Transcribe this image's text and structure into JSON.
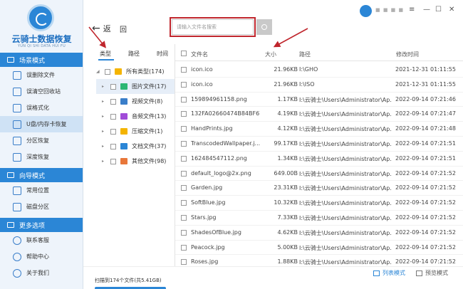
{
  "brand": {
    "title": "云骑士数据恢复",
    "subtitle": "YUN QI SHI DATA HUI FU"
  },
  "sidebar": {
    "sections": [
      {
        "label": "场景模式",
        "items": [
          "误删除文件",
          "误清空回收站",
          "误格式化",
          "U盘/内存卡恢复",
          "分区恢复",
          "深度恢复"
        ]
      },
      {
        "label": "向导模式",
        "items": [
          "常用位置",
          "磁盘分区"
        ]
      },
      {
        "label": "更多选项",
        "items": [
          "联系客服",
          "帮助中心",
          "关于我们"
        ]
      }
    ],
    "active_item": "U盘/内存卡恢复"
  },
  "topbar": {
    "back_label": "返",
    "refresh_label": "回",
    "search_placeholder": "请输入文件名搜索",
    "user_name": "■ ■ ■ ■"
  },
  "category_tabs": [
    "类型",
    "路径",
    "时间"
  ],
  "categories": [
    {
      "label": "所有类型(174)",
      "icon": "folder-icon",
      "color": "#f4b400"
    },
    {
      "label": "图片文件(17)",
      "icon": "image-icon",
      "color": "#2bb673"
    },
    {
      "label": "视频文件(8)",
      "icon": "video-icon",
      "color": "#3a7ec9"
    },
    {
      "label": "音频文件(13)",
      "icon": "audio-icon",
      "color": "#a04cd8"
    },
    {
      "label": "压缩文件(1)",
      "icon": "archive-icon",
      "color": "#f4b400"
    },
    {
      "label": "文档文件(37)",
      "icon": "document-icon",
      "color": "#2b86d6"
    },
    {
      "label": "其他文件(98)",
      "icon": "other-icon",
      "color": "#e8773a"
    }
  ],
  "table": {
    "headers": {
      "name": "文件名",
      "size": "大小",
      "path": "路径",
      "date": "修改时间"
    },
    "rows": [
      {
        "name": "icon.ico",
        "size": "21.96KB",
        "path": "I:\\GHO",
        "date": "2021-12-31 01:11:55"
      },
      {
        "name": "icon.ico",
        "size": "21.96KB",
        "path": "I:\\ISO",
        "date": "2021-12-31 01:11:55"
      },
      {
        "name": "159894961158.png",
        "size": "1.17KB",
        "path": "I:\\云骑士\\Users\\Administrator\\Ap...",
        "date": "2022-09-14 07:21:46"
      },
      {
        "name": "132FA02660474B84BF67...",
        "size": "4.19KB",
        "path": "I:\\云骑士\\Users\\Administrator\\Ap...",
        "date": "2022-09-14 07:21:47"
      },
      {
        "name": "HandPrints.jpg",
        "size": "4.12KB",
        "path": "I:\\云骑士\\Users\\Administrator\\Ap...",
        "date": "2022-09-14 07:21:48"
      },
      {
        "name": "TranscodedWallpaper.j...",
        "size": "99.17KB",
        "path": "I:\\云骑士\\Users\\Administrator\\Ap...",
        "date": "2022-09-14 07:21:51"
      },
      {
        "name": "162484547112.png",
        "size": "1.34KB",
        "path": "I:\\云骑士\\Users\\Administrator\\Ap...",
        "date": "2022-09-14 07:21:51"
      },
      {
        "name": "default_logo@2x.png",
        "size": "649.00B",
        "path": "I:\\云骑士\\Users\\Administrator\\Ap...",
        "date": "2022-09-14 07:21:52"
      },
      {
        "name": "Garden.jpg",
        "size": "23.31KB",
        "path": "I:\\云骑士\\Users\\Administrator\\Ap...",
        "date": "2022-09-14 07:21:52"
      },
      {
        "name": "SoftBlue.jpg",
        "size": "10.32KB",
        "path": "I:\\云骑士\\Users\\Administrator\\Ap...",
        "date": "2022-09-14 07:21:52"
      },
      {
        "name": "Stars.jpg",
        "size": "7.33KB",
        "path": "I:\\云骑士\\Users\\Administrator\\Ap...",
        "date": "2022-09-14 07:21:52"
      },
      {
        "name": "ShadesOfBlue.jpg",
        "size": "4.62KB",
        "path": "I:\\云骑士\\Users\\Administrator\\Ap...",
        "date": "2022-09-14 07:21:52"
      },
      {
        "name": "Peacock.jpg",
        "size": "5.00KB",
        "path": "I:\\云骑士\\Users\\Administrator\\Ap...",
        "date": "2022-09-14 07:21:52"
      },
      {
        "name": "Roses.jpg",
        "size": "1.88KB",
        "path": "I:\\云骑士\\Users\\Administrator\\Ap...",
        "date": "2022-09-14 07:21:52"
      }
    ]
  },
  "footer": {
    "scan_info": "扫描到174个文件(共5.41GB)",
    "list_mode": "列表模式",
    "preview_mode": "预览模式"
  },
  "colors": {
    "accent": "#2b86d6",
    "highlight": "#c0262d"
  }
}
